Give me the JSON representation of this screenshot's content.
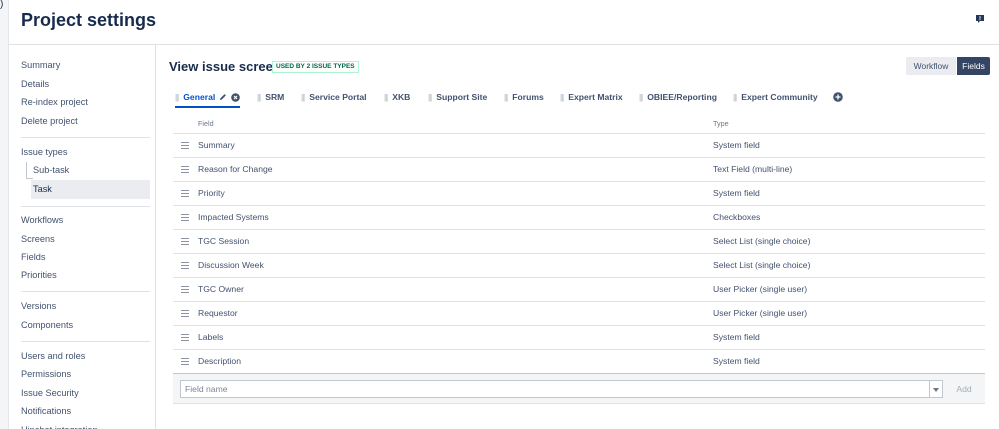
{
  "page": {
    "title": "Project settings",
    "corner_glyph": ")"
  },
  "sidebar": {
    "groups": [
      [
        "Summary",
        "Details",
        "Re-index project",
        "Delete project"
      ],
      [
        "Issue types",
        "Sub-task",
        "Task"
      ],
      [
        "Workflows",
        "Screens",
        "Fields",
        "Priorities"
      ],
      [
        "Versions",
        "Components"
      ],
      [
        "Users and roles",
        "Permissions",
        "Issue Security",
        "Notifications",
        "Hipchat integration"
      ]
    ],
    "active": "Task"
  },
  "screen": {
    "title": "View issue screen",
    "badge": "USED BY 2 ISSUE TYPES",
    "toggle": {
      "workflow": "Workflow",
      "fields": "Fields"
    }
  },
  "tabs": [
    "General",
    "SRM",
    "Service Portal",
    "XKB",
    "Support Site",
    "Forums",
    "Expert Matrix",
    "OBIEE/Reporting",
    "Expert Community"
  ],
  "table": {
    "headers": {
      "field": "Field",
      "type": "Type"
    },
    "rows": [
      {
        "field": "Summary",
        "type": "System field"
      },
      {
        "field": "Reason for Change",
        "type": "Text Field (multi-line)"
      },
      {
        "field": "Priority",
        "type": "System field"
      },
      {
        "field": "Impacted Systems",
        "type": "Checkboxes"
      },
      {
        "field": "TGC Session",
        "type": "Select List (single choice)"
      },
      {
        "field": "Discussion Week",
        "type": "Select List (single choice)"
      },
      {
        "field": "TGC Owner",
        "type": "User Picker (single user)"
      },
      {
        "field": "Requestor",
        "type": "User Picker (single user)"
      },
      {
        "field": "Labels",
        "type": "System field"
      },
      {
        "field": "Description",
        "type": "System field"
      }
    ]
  },
  "add_field": {
    "placeholder": "Field name",
    "button": "Add"
  },
  "icons": {
    "feedback": "feedback-icon",
    "edit": "pencil-icon",
    "close": "close-icon",
    "add_tab": "plus-icon",
    "drag": "drag-handle-icon",
    "dropdown": "chevron-down-icon"
  },
  "colors": {
    "accent": "#0052cc",
    "fields_button": "#344563",
    "badge_text": "#006644"
  }
}
